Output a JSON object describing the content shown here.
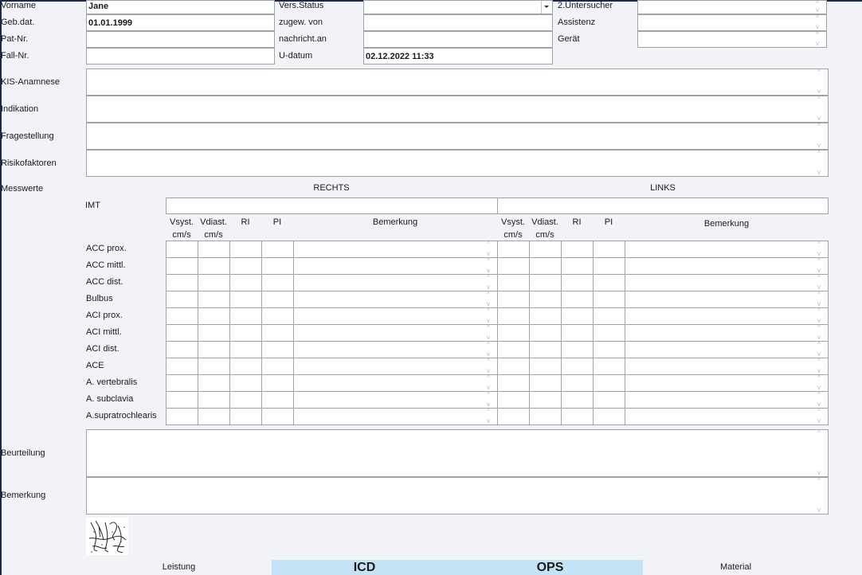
{
  "patient": {
    "vorname_label": "Vorname",
    "vorname_value": "Jane",
    "gebdat_label": "Geb.dat.",
    "gebdat_value": "01.01.1999",
    "patnr_label": "Pat-Nr.",
    "patnr_value": "",
    "fallnr_label": "Fall-Nr.",
    "fallnr_value": ""
  },
  "admin": {
    "versstatus_label": "Vers.Status",
    "versstatus_value": "",
    "zugewvon_label": "zugew. von",
    "zugewvon_value": "",
    "nachricht_label": "nachricht.an",
    "nachricht_value": "",
    "udatum_label": "U-datum",
    "udatum_value": "02.12.2022 11:33"
  },
  "staff": {
    "untersucher2_label": "2.Untersucher",
    "assistenz_label": "Assistenz",
    "geraet_label": "Gerät"
  },
  "text_sections": {
    "kis_label": "KIS-Anamnese",
    "indikation_label": "Indikation",
    "fragestellung_label": "Fragestellung",
    "risikofaktoren_label": "Risikofaktoren"
  },
  "measurements": {
    "section_label": "Messwerte",
    "right_header": "RECHTS",
    "left_header": "LINKS",
    "imt_label": "IMT",
    "columns": {
      "vsyst_line1": "Vsyst.",
      "vsyst_line2": "cm/s",
      "vdiast_line1": "Vdiast.",
      "vdiast_line2": "cm/s",
      "ri": "RI",
      "pi": "PI",
      "bemerkung": "Bemerkung"
    },
    "rows": [
      "ACC prox.",
      "ACC mittl.",
      "ACC dist.",
      "Bulbus",
      "ACI prox.",
      "ACI mittl.",
      "ACI dist.",
      "ACE",
      "A. vertebralis",
      "A. subclavia",
      "A.supratrochlearis"
    ]
  },
  "bottom": {
    "beurteilung_label": "Beurteilung",
    "bemerkung_label": "Bemerkung"
  },
  "tabs": {
    "leistung": "Leistung",
    "icd": "ICD",
    "ops": "OPS",
    "material": "Material"
  },
  "icons": {
    "spinner": "up-down-arrows",
    "dropdown": "caret-down",
    "signature": "signature-image"
  },
  "colors": {
    "background": "#f1f3f7",
    "field": "#ffffff",
    "tab_highlight": "#c5e3f6"
  }
}
